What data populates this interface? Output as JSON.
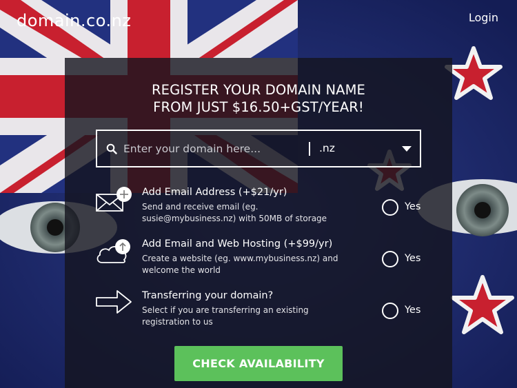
{
  "header": {
    "logo_text": "domain.co.nz",
    "login_label": "Login"
  },
  "hero": {
    "headline_line1": "REGISTER YOUR DOMAIN NAME",
    "headline_line2": "FROM JUST $16.50+GST/YEAR!"
  },
  "search": {
    "placeholder": "Enter your domain here...",
    "value": "",
    "tld_selected": ".nz"
  },
  "options": [
    {
      "icon": "envelope-plus-icon",
      "title": "Add Email Address (+$21/yr)",
      "desc": "Send and receive email (eg. susie@mybusiness.nz) with 50MB of storage",
      "yes_label": "Yes"
    },
    {
      "icon": "cloud-upload-icon",
      "title": "Add Email and Web Hosting (+$99/yr)",
      "desc": "Create a website (eg. www.mybusiness.nz) and welcome the world",
      "yes_label": "Yes"
    },
    {
      "icon": "arrow-right-icon",
      "title": "Transferring your domain?",
      "desc": "Select if you are transferring an existing registration to us",
      "yes_label": "Yes"
    }
  ],
  "cta": {
    "label": "CHECK AVAILABILITY"
  },
  "colors": {
    "cta_green": "#5cc15b",
    "flag_blue": "#1f2f7a",
    "flag_red": "#c8202f"
  }
}
